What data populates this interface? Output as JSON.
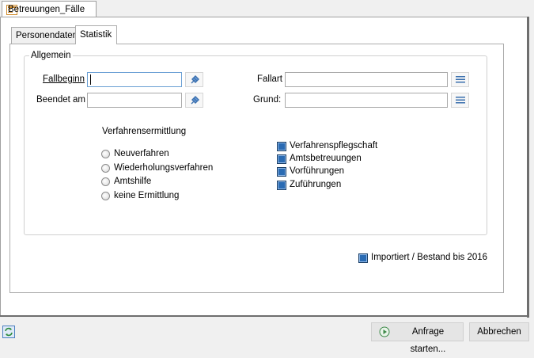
{
  "window": {
    "tab_title": "Betreuungen_Fälle"
  },
  "tabs": [
    {
      "label": "Personendaten",
      "active": false
    },
    {
      "label": "Statistik",
      "active": true
    }
  ],
  "group": {
    "legend": "Allgemein"
  },
  "fields": {
    "fallbeginn": {
      "label": "Fallbeginn",
      "value": ""
    },
    "beendet_am": {
      "label": "Beendet am",
      "value": ""
    },
    "fallart": {
      "label": "Fallart",
      "value": ""
    },
    "grund": {
      "label": "Grund:",
      "value": ""
    }
  },
  "verfahren": {
    "title": "Verfahrensermittlung",
    "options": [
      "Neuverfahren",
      "Wiederholungsverfahren",
      "Amtshilfe",
      "keine Ermittlung"
    ]
  },
  "checks": [
    "Verfahrenspflegschaft",
    "Amtsbetreuungen",
    "Vorführungen",
    "Zuführungen"
  ],
  "imported": {
    "label": "Importiert / Bestand bis 2016",
    "checked": true
  },
  "footer": {
    "start_label": "Anfrage starten...",
    "cancel_label": "Abbrechen"
  },
  "icons": {
    "window": "form-icon",
    "date_picker": "pin-icon",
    "list": "list-icon",
    "start": "play-icon",
    "refresh": "refresh-icon"
  },
  "colors": {
    "accent": "#2a6bb3",
    "background": "#f0f0f0"
  }
}
